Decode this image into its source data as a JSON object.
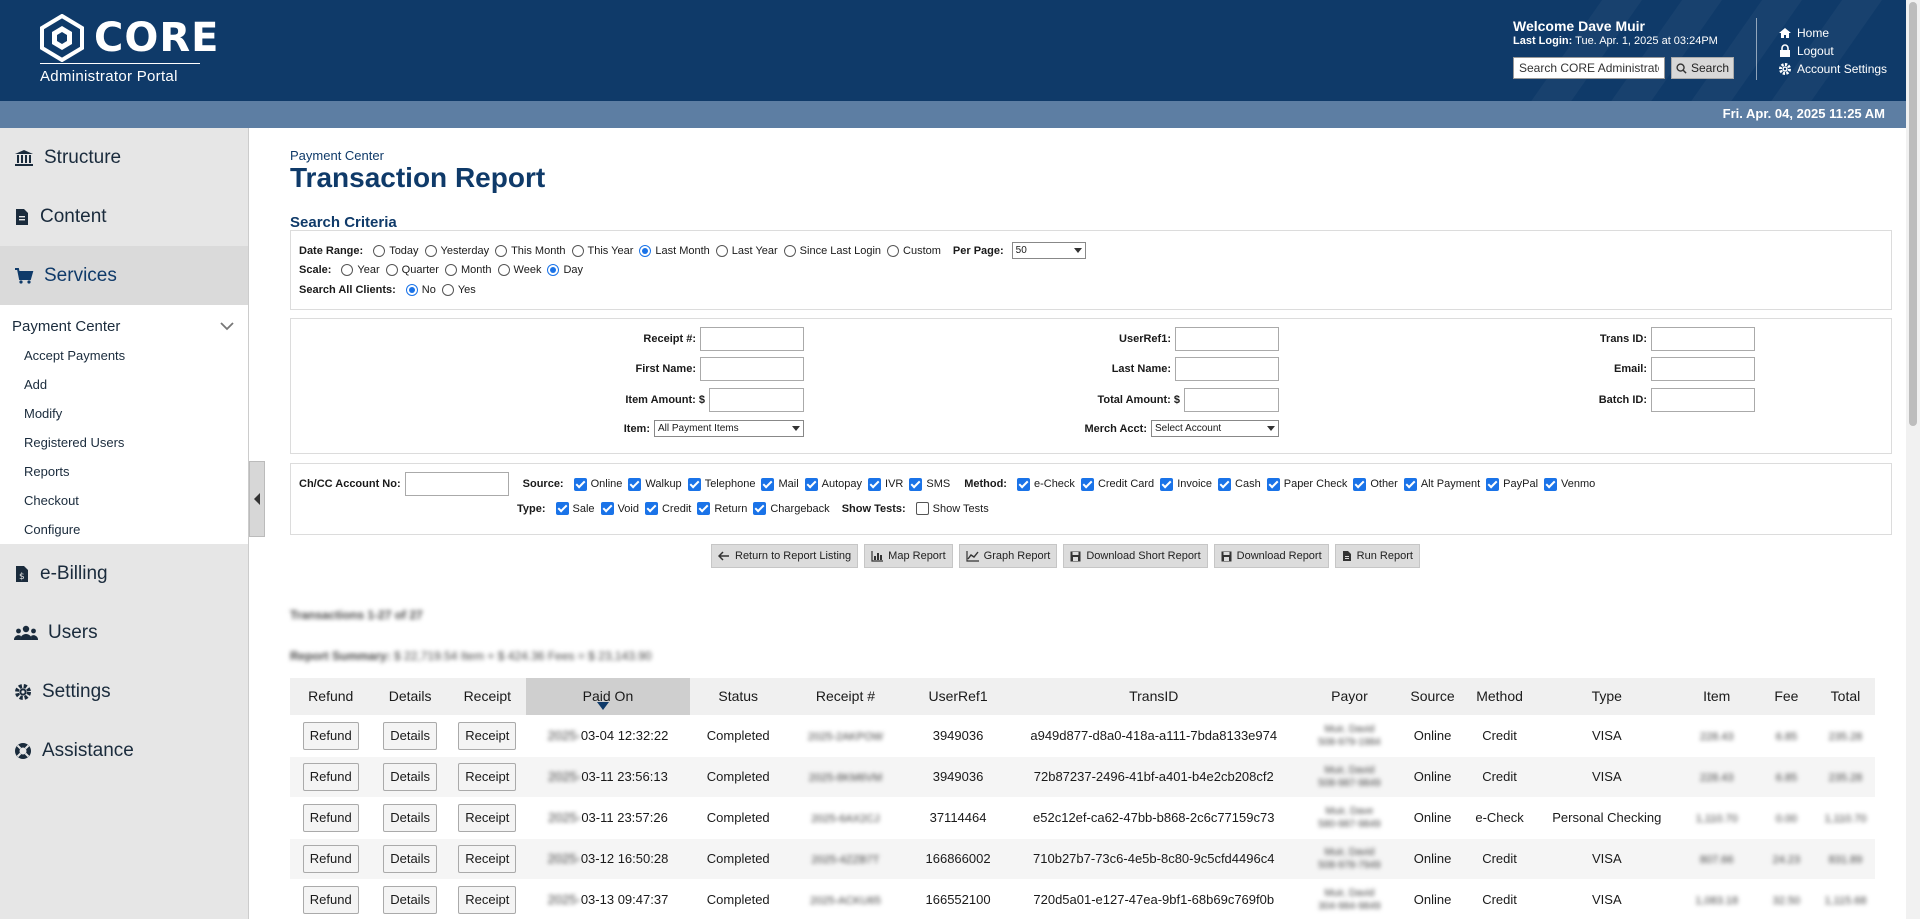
{
  "header": {
    "brand": "CORE",
    "subtitle": "Administrator Portal",
    "welcome": "Welcome Dave Muir",
    "last_login_label": "Last Login:",
    "last_login_value": "Tue. Apr. 1, 2025 at 03:24PM",
    "search_placeholder": "Search CORE Administrator",
    "search_button": "Search",
    "links": {
      "home": "Home",
      "logout": "Logout",
      "account_settings": "Account Settings"
    },
    "date": "Fri. Apr. 04, 2025 11:25 AM"
  },
  "sidebar": {
    "items": [
      {
        "label": "Structure",
        "icon": "bank-icon"
      },
      {
        "label": "Content",
        "icon": "document-icon"
      },
      {
        "label": "Services",
        "icon": "cart-icon"
      }
    ],
    "section_head": "Payment Center",
    "sub_items": [
      "Accept Payments",
      "Add",
      "Modify",
      "Registered Users",
      "Reports",
      "Checkout",
      "Configure"
    ],
    "items_bottom": [
      {
        "label": "e-Billing",
        "icon": "invoice-icon"
      },
      {
        "label": "Users",
        "icon": "users-icon"
      },
      {
        "label": "Settings",
        "icon": "gear-icon"
      },
      {
        "label": "Assistance",
        "icon": "lifebuoy-icon"
      }
    ]
  },
  "page": {
    "breadcrumb": "Payment Center",
    "title": "Transaction Report",
    "section": "Search Criteria"
  },
  "criteria": {
    "date_range_label": "Date Range:",
    "date_ranges": [
      "Today",
      "Yesterday",
      "This Month",
      "This Year",
      "Last Month",
      "Last Year",
      "Since Last Login",
      "Custom"
    ],
    "date_range_selected": "Last Month",
    "per_page_label": "Per Page:",
    "per_page_value": "50",
    "scale_label": "Scale:",
    "scales": [
      "Year",
      "Quarter",
      "Month",
      "Week",
      "Day"
    ],
    "scale_selected": "Day",
    "all_clients_label": "Search All Clients:",
    "all_clients": [
      "No",
      "Yes"
    ],
    "all_clients_selected": "No"
  },
  "fields": {
    "receipt": "Receipt #:",
    "first_name": "First Name:",
    "item_amount": "Item Amount: $",
    "item": "Item:",
    "item_value": "All Payment Items",
    "userref": "UserRef1:",
    "last_name": "Last Name:",
    "total_amount": "Total Amount: $",
    "merch": "Merch Acct:",
    "merch_value": "Select Account",
    "trans_id": "Trans ID:",
    "email": "Email:",
    "batch_id": "Batch ID:"
  },
  "filters": {
    "account_label": "Ch/CC Account No:",
    "source_label": "Source:",
    "sources": [
      "Online",
      "Walkup",
      "Telephone",
      "Mail",
      "Autopay",
      "IVR",
      "SMS"
    ],
    "method_label": "Method:",
    "methods": [
      "e-Check",
      "Credit Card",
      "Invoice",
      "Cash",
      "Paper Check",
      "Other",
      "Alt Payment",
      "PayPal",
      "Venmo"
    ],
    "type_label": "Type:",
    "types": [
      "Sale",
      "Void",
      "Credit",
      "Return",
      "Chargeback"
    ],
    "show_tests_label": "Show Tests:",
    "show_tests_option": "Show Tests"
  },
  "actions": [
    "Return to Report Listing",
    "Map Report",
    "Graph Report",
    "Download Short Report",
    "Download Report",
    "Run Report"
  ],
  "report": {
    "count": "Transactions 1-27 of 27",
    "summary_label": "Report Summary:",
    "summary_value": "$ 22,719.54 Item + $ 424.36 Fees = $ 23,143.90"
  },
  "table": {
    "columns": [
      "Refund",
      "Details",
      "Receipt",
      "Paid On",
      "Status",
      "Receipt #",
      "UserRef1",
      "TransID",
      "Payor",
      "Source",
      "Method",
      "Type",
      "Item",
      "Fee",
      "Total"
    ],
    "button_labels": {
      "refund": "Refund",
      "details": "Details",
      "receipt": "Receipt"
    },
    "rows": [
      {
        "year": "2025-",
        "paid": "03-04 12:32:22",
        "status": "Completed",
        "receipt": "2025-2AKPOW",
        "userref": "3949036",
        "transid": "a949d877-d8a0-418a-a111-7bda8133e974",
        "payor1": "Muir, David",
        "payor2": "508-979-1984",
        "source": "Online",
        "method": "Credit",
        "type": "VISA",
        "item": "228.43",
        "fee": "6.85",
        "total": "235.28"
      },
      {
        "year": "2025-",
        "paid": "03-11 23:56:13",
        "status": "Completed",
        "receipt": "2025-8KM6VM",
        "userref": "3949036",
        "transid": "72b87237-2496-41bf-a401-b4e2cb208cf2",
        "payor1": "Muir, David",
        "payor2": "508-987-9849",
        "source": "Online",
        "method": "Credit",
        "type": "VISA",
        "item": "228.43",
        "fee": "6.85",
        "total": "235.28"
      },
      {
        "year": "2025-",
        "paid": "03-11 23:57:26",
        "status": "Completed",
        "receipt": "2025-6AX2CJ",
        "userref": "37114464",
        "transid": "e52c12ef-ca62-47bb-b868-2c6c77159c73",
        "payor1": "Muir, Dave",
        "payor2": "580-987-9849",
        "source": "Online",
        "method": "e-Check",
        "type": "Personal Checking",
        "item": "1,110.70",
        "fee": "0.00",
        "total": "1,110.70"
      },
      {
        "year": "2025-",
        "paid": "03-12 16:50:28",
        "status": "Completed",
        "receipt": "2025-4ZZB7T",
        "userref": "166866002",
        "transid": "710b27b7-73c6-4e5b-8c80-9c5cfd4496c4",
        "payor1": "Muir, David",
        "payor2": "508-978-7949",
        "source": "Online",
        "method": "Credit",
        "type": "VISA",
        "item": "807.66",
        "fee": "24.23",
        "total": "831.89"
      },
      {
        "year": "2025-",
        "paid": "03-13 09:47:37",
        "status": "Completed",
        "receipt": "2025-ACKU65",
        "userref": "166552100",
        "transid": "720d5a01-e127-47ea-9bf1-68b69c769f0b",
        "payor1": "Muir, David",
        "payor2": "304-984-9849",
        "source": "Online",
        "method": "Credit",
        "type": "VISA",
        "item": "1,083.18",
        "fee": "32.50",
        "total": "1,115.68"
      }
    ]
  },
  "colors": {
    "header": "#0f3a69",
    "datebar": "#5d7ea3",
    "accent": "#1a73e8"
  }
}
